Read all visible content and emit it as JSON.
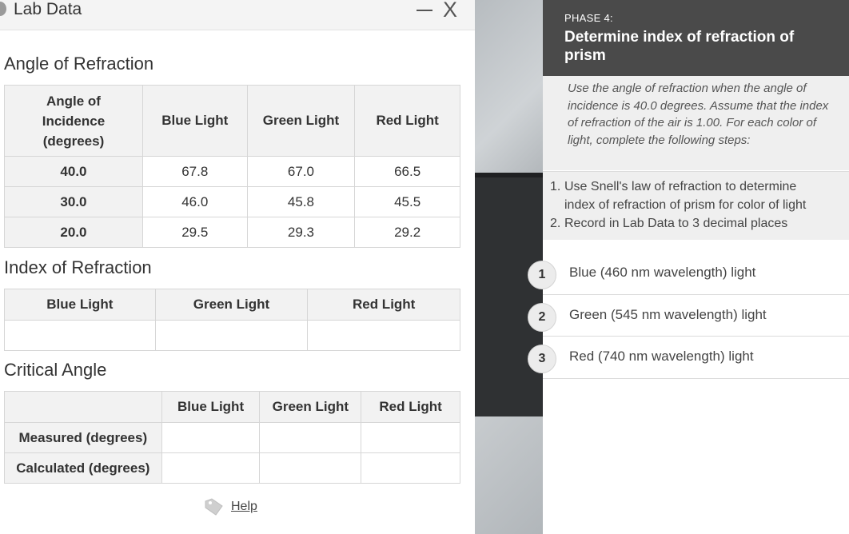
{
  "lab": {
    "title": "Lab Data",
    "minimize_label": "—",
    "close_label": "X",
    "refraction": {
      "title": "Angle of Refraction",
      "header": [
        "Angle of Incidence (degrees)",
        "Blue Light",
        "Green Light",
        "Red Light"
      ],
      "rows": [
        {
          "incidence": "40.0",
          "blue": "67.8",
          "green": "67.0",
          "red": "66.5"
        },
        {
          "incidence": "30.0",
          "blue": "46.0",
          "green": "45.8",
          "red": "45.5"
        },
        {
          "incidence": "20.0",
          "blue": "29.5",
          "green": "29.3",
          "red": "29.2"
        }
      ]
    },
    "index": {
      "title": "Index of Refraction",
      "header": [
        "Blue Light",
        "Green Light",
        "Red Light"
      ],
      "values": [
        "",
        "",
        ""
      ]
    },
    "critical": {
      "title": "Critical Angle",
      "header": [
        "",
        "Blue Light",
        "Green Light",
        "Red Light"
      ],
      "rows": [
        {
          "label": "Measured (degrees)",
          "blue": "",
          "green": "",
          "red": ""
        },
        {
          "label": "Calculated (degrees)",
          "blue": "",
          "green": "",
          "red": ""
        }
      ]
    },
    "help_label": "Help",
    "help_icon": "tag-icon"
  },
  "phase": {
    "label": "PHASE 4:",
    "title": "Determine index of refraction of prism",
    "intro": "Use the angle of refraction when the angle of incidence is 40.0 degrees. Assume that the index of refraction of the air is 1.00. For each color of light, complete the following steps:",
    "steps": [
      {
        "num": "1.",
        "line1": "Use Snell's law of refraction to determine",
        "line2": "index of refraction of prism for color of light"
      },
      {
        "num": "2.",
        "line1": "Record in Lab Data to 3 decimal places",
        "line2": ""
      }
    ],
    "tasks": [
      {
        "num": "1",
        "label": "Blue (460 nm wavelength) light"
      },
      {
        "num": "2",
        "label": "Green (545 nm wavelength) light"
      },
      {
        "num": "3",
        "label": "Red (740 nm wavelength) light"
      }
    ]
  },
  "colors": {
    "header_bg": "#4a4a4a",
    "panel_bg": "#efefef",
    "table_header_bg": "#f2f2f2",
    "border": "#d6d6d6"
  }
}
